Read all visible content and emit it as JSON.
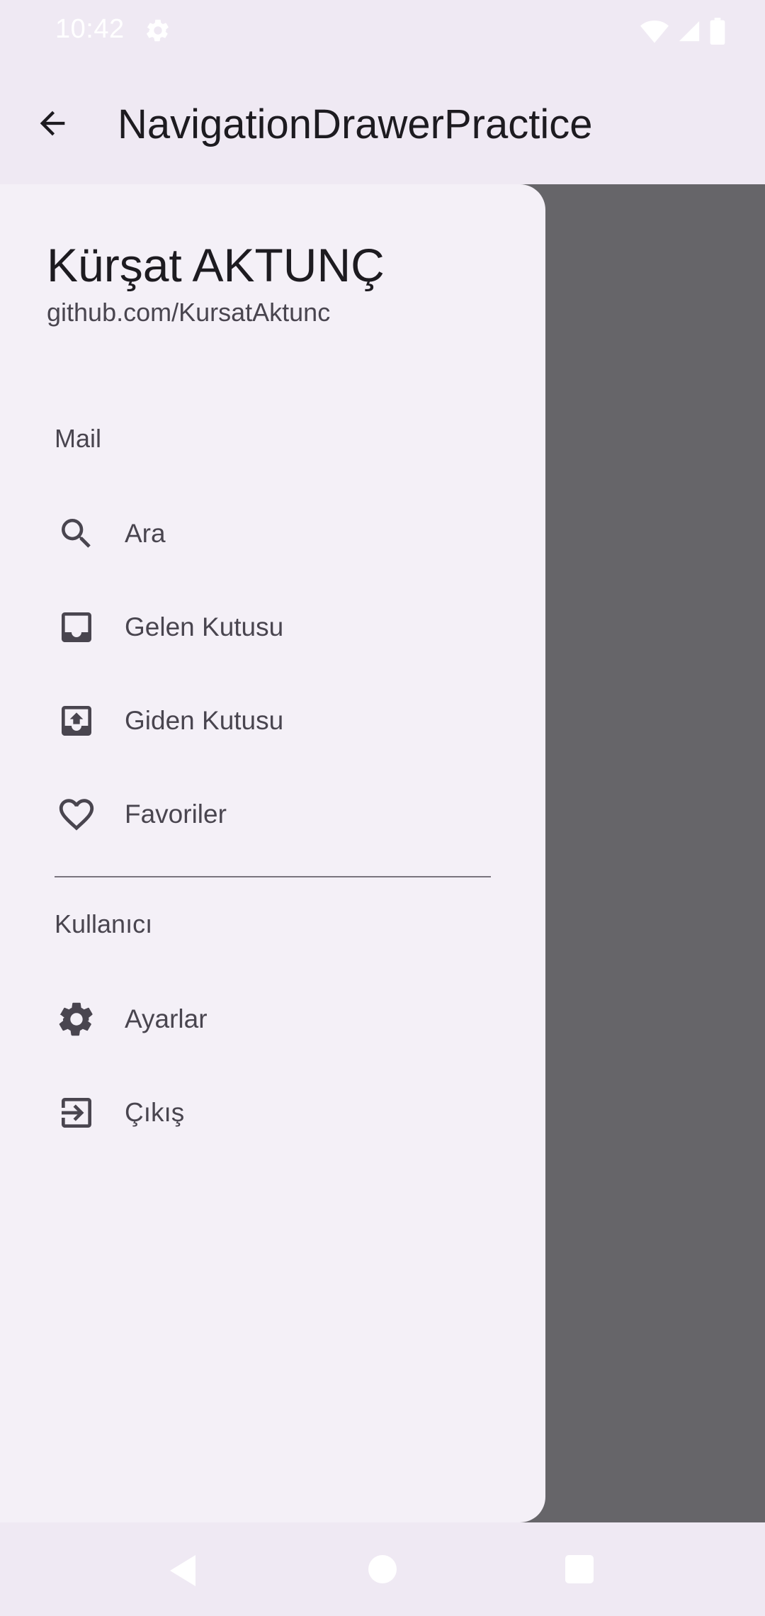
{
  "status_bar": {
    "time": "10:42",
    "left_icon": "gear-icon",
    "right_icons": [
      "wifi-icon",
      "signal-icon",
      "battery-icon"
    ]
  },
  "app_bar": {
    "nav_icon": "arrow-back-icon",
    "title": "NavigationDrawerPractice"
  },
  "drawer": {
    "header": {
      "name": "Kürşat AKTUNÇ",
      "subtitle": "github.com/KursatAktunc"
    },
    "sections": [
      {
        "title": "Mail",
        "items": [
          {
            "label": "Ara",
            "icon": "search-icon"
          },
          {
            "label": "Gelen Kutusu",
            "icon": "inbox-icon"
          },
          {
            "label": "Giden Kutusu",
            "icon": "outbox-icon"
          },
          {
            "label": "Favoriler",
            "icon": "heart-icon"
          }
        ]
      },
      {
        "title": "Kullanıcı",
        "items": [
          {
            "label": "Ayarlar",
            "icon": "settings-icon"
          },
          {
            "label": "Çıkış",
            "icon": "logout-icon"
          }
        ]
      }
    ]
  },
  "colors": {
    "bar_background": "#efe9f3",
    "drawer_background": "#f4f0f7",
    "scrim": "#666569",
    "icon": "#49454f",
    "text_primary": "#1d1b20",
    "text_secondary": "#49454f"
  },
  "system_nav": {
    "buttons": [
      "back-triangle-icon",
      "home-circle-icon",
      "recents-square-icon"
    ]
  }
}
